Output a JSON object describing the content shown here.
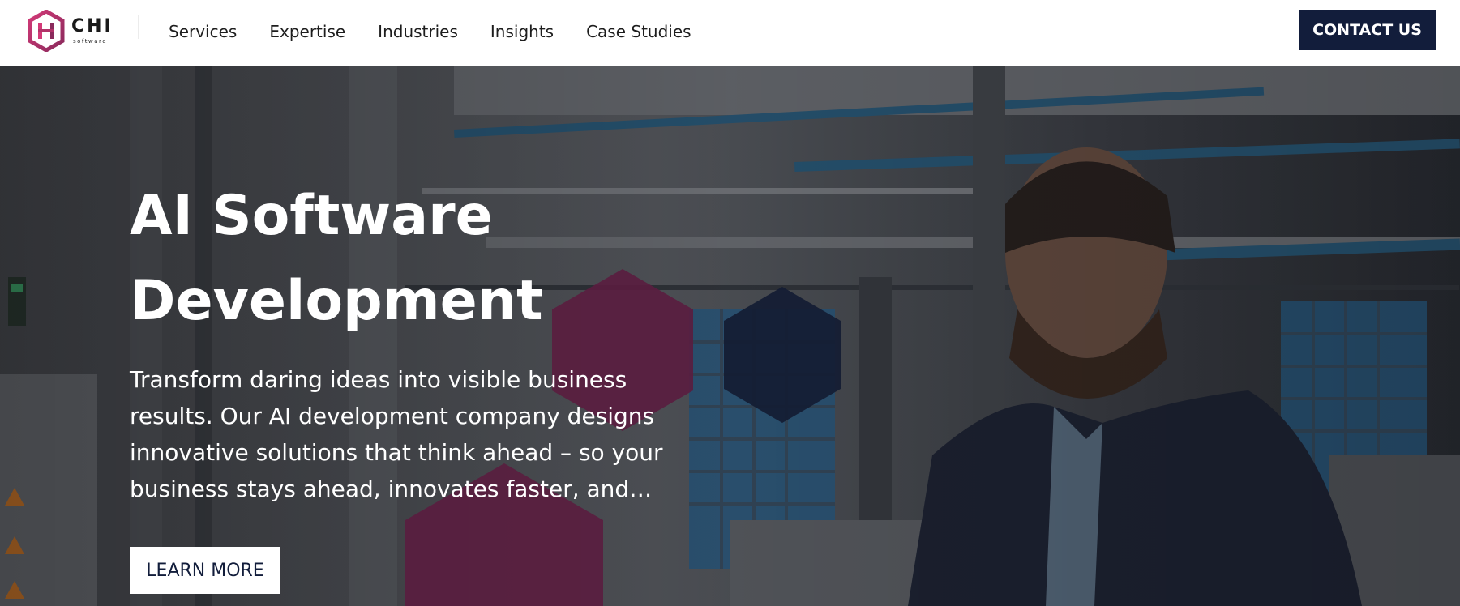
{
  "brand": {
    "name": "CHI",
    "sub": "software",
    "accent_color": "#d33a78"
  },
  "nav": {
    "items": [
      "Services",
      "Expertise",
      "Industries",
      "Insights",
      "Case Studies"
    ]
  },
  "header": {
    "contact_label": "CONTACT US",
    "contact_color": "#121d3b"
  },
  "hero": {
    "title_line1": "AI Software",
    "title_line2": "Development",
    "description": "Transform daring ideas into visible business results. Our AI development company designs innovative solutions that think ahead – so your business stays ahead, innovates faster, and…",
    "cta_label": "LEARN MORE",
    "hex_colors": [
      "#5a1d3f",
      "#141c33"
    ]
  }
}
